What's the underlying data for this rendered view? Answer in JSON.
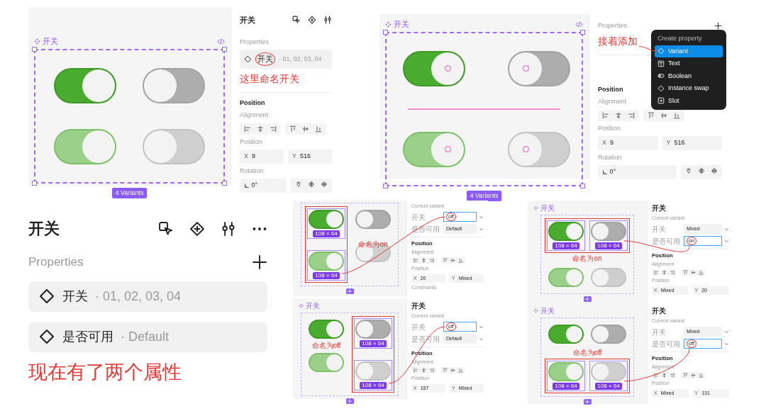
{
  "panels": [
    {
      "canvas": {
        "label": "开关",
        "code_icon": true,
        "frame_selected": true,
        "badge": "4 Variants",
        "toggles": [
          {
            "on": true,
            "kind": "normal",
            "selected": false
          },
          {
            "on": false,
            "kind": "normal",
            "selected": false
          },
          {
            "on": true,
            "kind": "disabled",
            "selected": false
          },
          {
            "on": false,
            "kind": "disabled",
            "selected": false
          }
        ]
      },
      "inspector": [
        {
          "kind": "header",
          "title": "开关",
          "icons": [
            {
              "kind": "select"
            },
            {
              "kind": "component"
            },
            {
              "kind": "sliders"
            }
          ]
        },
        {
          "kind": "properties",
          "title": "Properties",
          "rows": [
            {
              "name": "开关",
              "values": "· 01, 02, 03, 04",
              "circled": true
            }
          ],
          "note": "这里命名开关"
        },
        {
          "kind": "position",
          "title": "Position",
          "alignment": "Alignment",
          "position": "Position",
          "x": {
            "label": "X",
            "value": "9"
          },
          "y": {
            "label": "Y",
            "value": "516"
          },
          "rotation": "Rotation",
          "angle": "0°"
        }
      ]
    },
    {
      "canvas": {
        "label": "开关",
        "code_icon": true,
        "frame_selected": true,
        "guides": true,
        "badge": "4 Variants",
        "toggles": [
          {
            "on": true,
            "kind": "normal",
            "selected": false
          },
          {
            "on": false,
            "kind": "normal",
            "selected": false
          },
          {
            "on": true,
            "kind": "disabled",
            "selected": false
          },
          {
            "on": false,
            "kind": "disabled",
            "selected": false
          }
        ]
      },
      "inspector": [
        {
          "kind": "properties",
          "title": "Properties",
          "add": true,
          "note": "接着添加"
        },
        {
          "kind": "menu",
          "title": "Create property",
          "items": [
            {
              "kind": "variant",
              "label": "Variant",
              "selected": true
            },
            {
              "kind": "text",
              "label": "Text",
              "selected": false
            },
            {
              "kind": "boolean",
              "label": "Boolean",
              "selected": false
            },
            {
              "kind": "swap",
              "label": "Instance swap",
              "selected": false
            },
            {
              "kind": "slot",
              "label": "Slot",
              "selected": false
            }
          ]
        },
        {
          "kind": "position",
          "title": "Position",
          "alignment": "Alignment",
          "position": "Position",
          "x": {
            "label": "X",
            "value": "9"
          },
          "y": {
            "label": "Y",
            "value": "516"
          },
          "rotation": "Rotation",
          "angle": "0°"
        }
      ]
    },
    {
      "inspector": [
        {
          "kind": "header",
          "title": "开关",
          "icons": [
            {
              "kind": "select"
            },
            {
              "kind": "component"
            },
            {
              "kind": "sliders"
            },
            {
              "kind": "more"
            }
          ]
        },
        {
          "kind": "properties",
          "title": "Properties",
          "add": true,
          "rows": [
            {
              "name": "开关",
              "values": "· 01, 02, 03, 04",
              "circled": false
            },
            {
              "name": "是否可用",
              "values": "· Default",
              "circled": false
            }
          ],
          "note": "现在有了两个属性"
        }
      ]
    },
    {
      "canvas": {
        "add_button": true,
        "highlight": {
          "kind": "column-left",
          "note": "命名为on"
        },
        "toggles": [
          {
            "on": true,
            "kind": "normal",
            "selected": true,
            "size": "108 × 64"
          },
          {
            "on": false,
            "kind": "normal",
            "selected": false
          },
          {
            "on": true,
            "kind": "disabled",
            "selected": true,
            "size": "108 × 64"
          },
          {
            "on": false,
            "kind": "disabled",
            "selected": false
          }
        ]
      },
      "inspector": [
        {
          "kind": "variant",
          "subtitle": "Current variant",
          "rows": [
            {
              "label": "开关",
              "value": "off",
              "focused": true,
              "circled": true,
              "dropdown": true
            },
            {
              "label": "是否可用",
              "value": "Default",
              "focused": false,
              "circled": false,
              "dropdown": true
            }
          ]
        },
        {
          "kind": "position",
          "title": "Position",
          "alignment": "Alignment",
          "position": "Position",
          "x": {
            "label": "X",
            "value": "20"
          },
          "y": {
            "label": "Y",
            "value": "Mixed"
          },
          "constraints": "Constraints"
        }
      ]
    },
    {
      "canvas": {
        "label": "开关",
        "add_button": true,
        "highlight": {
          "kind": "column-right",
          "note": "命名为off"
        },
        "toggles": [
          {
            "on": true,
            "kind": "normal",
            "selected": false
          },
          {
            "on": false,
            "kind": "normal",
            "selected": true,
            "size": "108 × 64"
          },
          {
            "on": true,
            "kind": "disabled",
            "selected": false
          },
          {
            "on": false,
            "kind": "disabled",
            "selected": true,
            "size": "108 × 64"
          }
        ]
      },
      "inspector": [
        {
          "kind": "variant",
          "title": "开关",
          "subtitle": "Current variant",
          "rows": [
            {
              "label": "开关",
              "value": "off",
              "focused": true,
              "circled": true,
              "dropdown": true
            },
            {
              "label": "是否可用",
              "value": "Default",
              "focused": false,
              "circled": false,
              "dropdown": true
            }
          ]
        },
        {
          "kind": "position",
          "title": "Position",
          "alignment": "Alignment",
          "position": "Position",
          "x": {
            "label": "X",
            "value": "157"
          },
          "y": {
            "label": "Y",
            "value": "Mixed"
          }
        }
      ]
    },
    {
      "canvas": {
        "label": "开关",
        "add_button": true,
        "highlight": {
          "kind": "row-top",
          "note": "命名为on"
        },
        "toggles": [
          {
            "on": true,
            "kind": "normal",
            "selected": true,
            "size": "108 × 64"
          },
          {
            "on": false,
            "kind": "normal",
            "selected": true,
            "size": "108 × 64"
          },
          {
            "on": true,
            "kind": "disabled",
            "selected": false
          },
          {
            "on": false,
            "kind": "disabled",
            "selected": false
          }
        ]
      },
      "inspector": [
        {
          "kind": "variant",
          "title": "开关",
          "subtitle": "Current variant",
          "rows": [
            {
              "label": "开关",
              "value": "Mixed",
              "focused": false,
              "circled": false,
              "dropdown": true
            },
            {
              "label": "是否可用",
              "value": "on",
              "focused": true,
              "circled": true,
              "dropdown": true
            }
          ]
        },
        {
          "kind": "position",
          "title": "Position",
          "alignment": "Alignment",
          "position": "Position",
          "x": {
            "label": "X",
            "value": "Mixed"
          },
          "y": {
            "label": "Y",
            "value": "20"
          }
        }
      ]
    },
    {
      "canvas": {
        "label": "开关",
        "add_button": true,
        "highlight": {
          "kind": "row-bottom",
          "note": "命名为off"
        },
        "toggles": [
          {
            "on": true,
            "kind": "normal",
            "selected": false
          },
          {
            "on": false,
            "kind": "normal",
            "selected": false
          },
          {
            "on": true,
            "kind": "disabled",
            "selected": true,
            "size": "108 × 64"
          },
          {
            "on": false,
            "kind": "disabled",
            "selected": true,
            "size": "108 × 64"
          }
        ]
      },
      "inspector": [
        {
          "kind": "variant",
          "title": "开关",
          "subtitle": "Current variant",
          "rows": [
            {
              "label": "开关",
              "value": "Mixed",
              "focused": false,
              "circled": false,
              "dropdown": true
            },
            {
              "label": "是否可用",
              "value": "off",
              "focused": true,
              "circled": true,
              "dropdown": true
            }
          ]
        },
        {
          "kind": "position",
          "title": "Position",
          "alignment": "Alignment",
          "position": "Position",
          "x": {
            "label": "X",
            "value": "Mixed"
          },
          "y": {
            "label": "Y",
            "value": "131"
          }
        }
      ]
    }
  ]
}
